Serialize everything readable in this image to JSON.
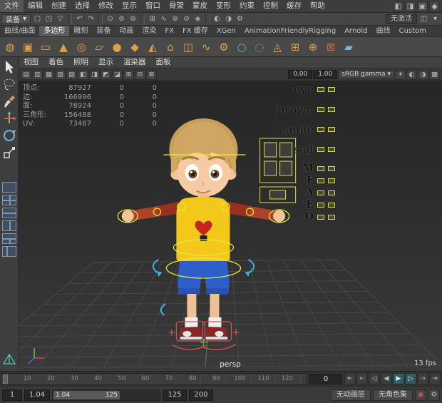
{
  "icons": {
    "caret": "▾"
  },
  "menu_bar": {
    "items": [
      "文件",
      "编辑",
      "创建",
      "选择",
      "修改",
      "显示",
      "窗口",
      "骨架",
      "蒙皮",
      "变形",
      "约束",
      "控制",
      "缓存",
      "帮助"
    ],
    "right_icons": [
      {
        "name": "workspace-left-icon",
        "glyph": "◧"
      },
      {
        "name": "workspace-right-icon",
        "glyph": "◨"
      },
      {
        "name": "workspace-full-icon",
        "glyph": "▣"
      },
      {
        "name": "whats-new-icon",
        "glyph": "◆"
      }
    ]
  },
  "status_line": {
    "workspace_label": "装备",
    "no_live_surface": "无激活",
    "groups": [
      {
        "items": [
          {
            "name": "new-scene-icon",
            "glyph": "▢"
          },
          {
            "name": "open-scene-icon",
            "glyph": "◳"
          },
          {
            "name": "save-scene-icon",
            "glyph": "▽"
          }
        ]
      },
      {
        "items": [
          {
            "name": "undo-icon",
            "glyph": "↶"
          },
          {
            "name": "redo-icon",
            "glyph": "↷"
          }
        ]
      },
      {
        "items": [
          {
            "name": "select-hierarchy-icon",
            "glyph": "⊙"
          },
          {
            "name": "select-object-icon",
            "glyph": "⊚"
          },
          {
            "name": "select-component-icon",
            "glyph": "⊛"
          }
        ]
      },
      {
        "items": [
          {
            "name": "snap-grid-icon",
            "glyph": "⊞"
          },
          {
            "name": "snap-curve-icon",
            "glyph": "∿"
          },
          {
            "name": "snap-point-icon",
            "glyph": "⊕"
          },
          {
            "name": "snap-projected-center-icon",
            "glyph": "⊘"
          },
          {
            "name": "make-live-icon",
            "glyph": "◈"
          }
        ]
      },
      {
        "items": [
          {
            "name": "render-frame-icon",
            "glyph": "◐"
          },
          {
            "name": "ipr-render-icon",
            "glyph": "◑"
          },
          {
            "name": "render-settings-icon",
            "glyph": "⚙"
          }
        ]
      }
    ],
    "right_icons": [
      {
        "name": "symmetry-icon",
        "glyph": "◫"
      },
      {
        "name": "options-caret-icon",
        "glyph": "▾"
      }
    ]
  },
  "shelf": {
    "tabs": [
      {
        "label": "曲线/曲面"
      },
      {
        "label": "多边形",
        "active": true
      },
      {
        "label": "雕刻"
      },
      {
        "label": "装备"
      },
      {
        "label": "动画"
      },
      {
        "label": "渲染"
      },
      {
        "label": "FX"
      },
      {
        "label": "FX 缓存"
      },
      {
        "label": "XGen"
      },
      {
        "label": "AnimationFriendlyRigging"
      },
      {
        "label": "Arnold"
      },
      {
        "label": "曲线"
      },
      {
        "label": "Custom"
      }
    ],
    "items": [
      {
        "name": "poly-sphere-icon",
        "glyph": "◍",
        "color": "#dfa04b"
      },
      {
        "name": "poly-cube-icon",
        "glyph": "▣",
        "color": "#dfa04b"
      },
      {
        "name": "poly-cylinder-icon",
        "glyph": "▭",
        "color": "#dfa04b"
      },
      {
        "name": "poly-cone-icon",
        "glyph": "▲",
        "color": "#dfa04b"
      },
      {
        "name": "poly-torus-icon",
        "glyph": "◎",
        "color": "#dfa04b"
      },
      {
        "name": "poly-plane-icon",
        "glyph": "▱",
        "color": "#dfa04b"
      },
      {
        "name": "poly-disc-icon",
        "glyph": "●",
        "color": "#dfa04b"
      },
      {
        "name": "poly-platonic-icon",
        "glyph": "◆",
        "color": "#dfa04b"
      },
      {
        "name": "poly-pyramid-icon",
        "glyph": "◭",
        "color": "#dfa04b"
      },
      {
        "name": "poly-prism-icon",
        "glyph": "⌂",
        "color": "#dfa04b"
      },
      {
        "name": "poly-pipe-icon",
        "glyph": "◫",
        "color": "#dfa04b"
      },
      {
        "name": "poly-helix-icon",
        "glyph": "∿",
        "color": "#dfa04b"
      },
      {
        "name": "poly-gear-icon",
        "glyph": "⚙",
        "color": "#dfa04b"
      },
      {
        "name": "poly-soccer-ball-icon",
        "glyph": "○",
        "color": "#56b8c4"
      },
      {
        "name": "poly-super-ellipse-icon",
        "glyph": "◌",
        "color": "#56b8c4"
      },
      {
        "name": "sculpt-tool-icon",
        "glyph": "◬",
        "color": "#dfa04b"
      },
      {
        "name": "mirror-icon",
        "glyph": "⊞",
        "color": "#dfa04b"
      },
      {
        "name": "combine-icon",
        "glyph": "⊕",
        "color": "#dfa04b"
      },
      {
        "name": "boolean-icon",
        "glyph": "⊠",
        "color": "#cf6a4f"
      },
      {
        "name": "quad-draw-icon",
        "glyph": "▰",
        "color": "#7fb2d9"
      }
    ]
  },
  "toolbox": {
    "tools": [
      "select-tool",
      "lasso-tool",
      "paint-select-tool",
      "move-tool",
      "rotate-tool",
      "scale-tool"
    ]
  },
  "viewport": {
    "panel_menus": [
      "视图",
      "着色",
      "照明",
      "显示",
      "渲染器",
      "面板"
    ],
    "toolbar": {
      "left_icons": [
        {
          "name": "select-camera-icon",
          "glyph": "▤"
        },
        {
          "name": "lock-camera-icon",
          "glyph": "▥"
        },
        {
          "name": "camera-attributes-icon",
          "glyph": "▦"
        },
        {
          "name": "bookmarks-icon",
          "glyph": "▧"
        },
        {
          "name": "image-plane-icon",
          "glyph": "▨"
        },
        {
          "name": "pan-zoom-icon",
          "glyph": "◧"
        },
        {
          "name": "film-gate-icon",
          "glyph": "◨"
        },
        {
          "name": "resolution-gate-icon",
          "glyph": "◩"
        },
        {
          "name": "gate-mask-icon",
          "glyph": "◪"
        },
        {
          "name": "field-chart-icon",
          "glyph": "⊞"
        },
        {
          "name": "safe-action-icon",
          "glyph": "⊟"
        },
        {
          "name": "safe-title-icon",
          "glyph": "⊠"
        }
      ],
      "exposure": "0.00",
      "gamma": "1.00",
      "view_transform": "sRGB gamma",
      "right_icons": [
        {
          "name": "lighting-icon",
          "glyph": "☀"
        },
        {
          "name": "shadows-icon",
          "glyph": "◐"
        },
        {
          "name": "ambient-occlusion-icon",
          "glyph": "◑"
        },
        {
          "name": "anti-aliasing-icon",
          "glyph": "▩"
        }
      ]
    },
    "hud": {
      "rows": [
        {
          "label": "顶点:",
          "value": "87927",
          "c1": "0",
          "c2": "0"
        },
        {
          "label": "边:",
          "value": "166996",
          "c1": "0",
          "c2": "0"
        },
        {
          "label": "面:",
          "value": "78924",
          "c1": "0",
          "c2": "0"
        },
        {
          "label": "三角形:",
          "value": "156488",
          "c1": "0",
          "c2": "0"
        },
        {
          "label": "UV:",
          "value": "73487",
          "c1": "0",
          "c2": "0"
        }
      ]
    },
    "face_controls": [
      {
        "label": "eye",
        "size": "word"
      },
      {
        "label": "brown",
        "size": "word"
      },
      {
        "label": "smile",
        "size": "word"
      },
      {
        "label": "sad",
        "size": "word"
      },
      {
        "label": "M",
        "size": "letter"
      },
      {
        "label": "F",
        "size": "letter"
      },
      {
        "label": "A",
        "size": "letter"
      },
      {
        "label": "E",
        "size": "letter"
      },
      {
        "label": "O",
        "size": "letter"
      }
    ],
    "camera_label": "persp",
    "fps": "13 fps"
  },
  "time_slider": {
    "ticks": [
      "10",
      "20",
      "30",
      "40",
      "50",
      "60",
      "70",
      "80",
      "90",
      "100",
      "110",
      "120"
    ],
    "current_frame": "0",
    "playback": [
      {
        "name": "go-to-start-button",
        "glyph": "⇤"
      },
      {
        "name": "step-back-frame-button",
        "glyph": "⇠"
      },
      {
        "name": "step-back-key-button",
        "glyph": "◁"
      },
      {
        "name": "play-backwards-button",
        "glyph": "◀"
      },
      {
        "name": "play-forwards-button",
        "glyph": "▶",
        "accent": true
      },
      {
        "name": "step-forward-key-button",
        "glyph": "▷",
        "accent": true
      },
      {
        "name": "step-forward-frame-button",
        "glyph": "⇢"
      },
      {
        "name": "go-to-end-button",
        "glyph": "⇥"
      }
    ]
  },
  "range_slider": {
    "anim_start": "1",
    "play_start": "1.04",
    "range_label_left": "1.04",
    "range_label_right": "125",
    "play_end": "125",
    "anim_end": "200",
    "anim_layer": "无动画层",
    "character_set": "无角色集"
  },
  "colors": {
    "rig_accent": "#e8e838",
    "shelf_icon_orange": "#dfa04b",
    "viewport_bg": "#2e2e2e"
  }
}
